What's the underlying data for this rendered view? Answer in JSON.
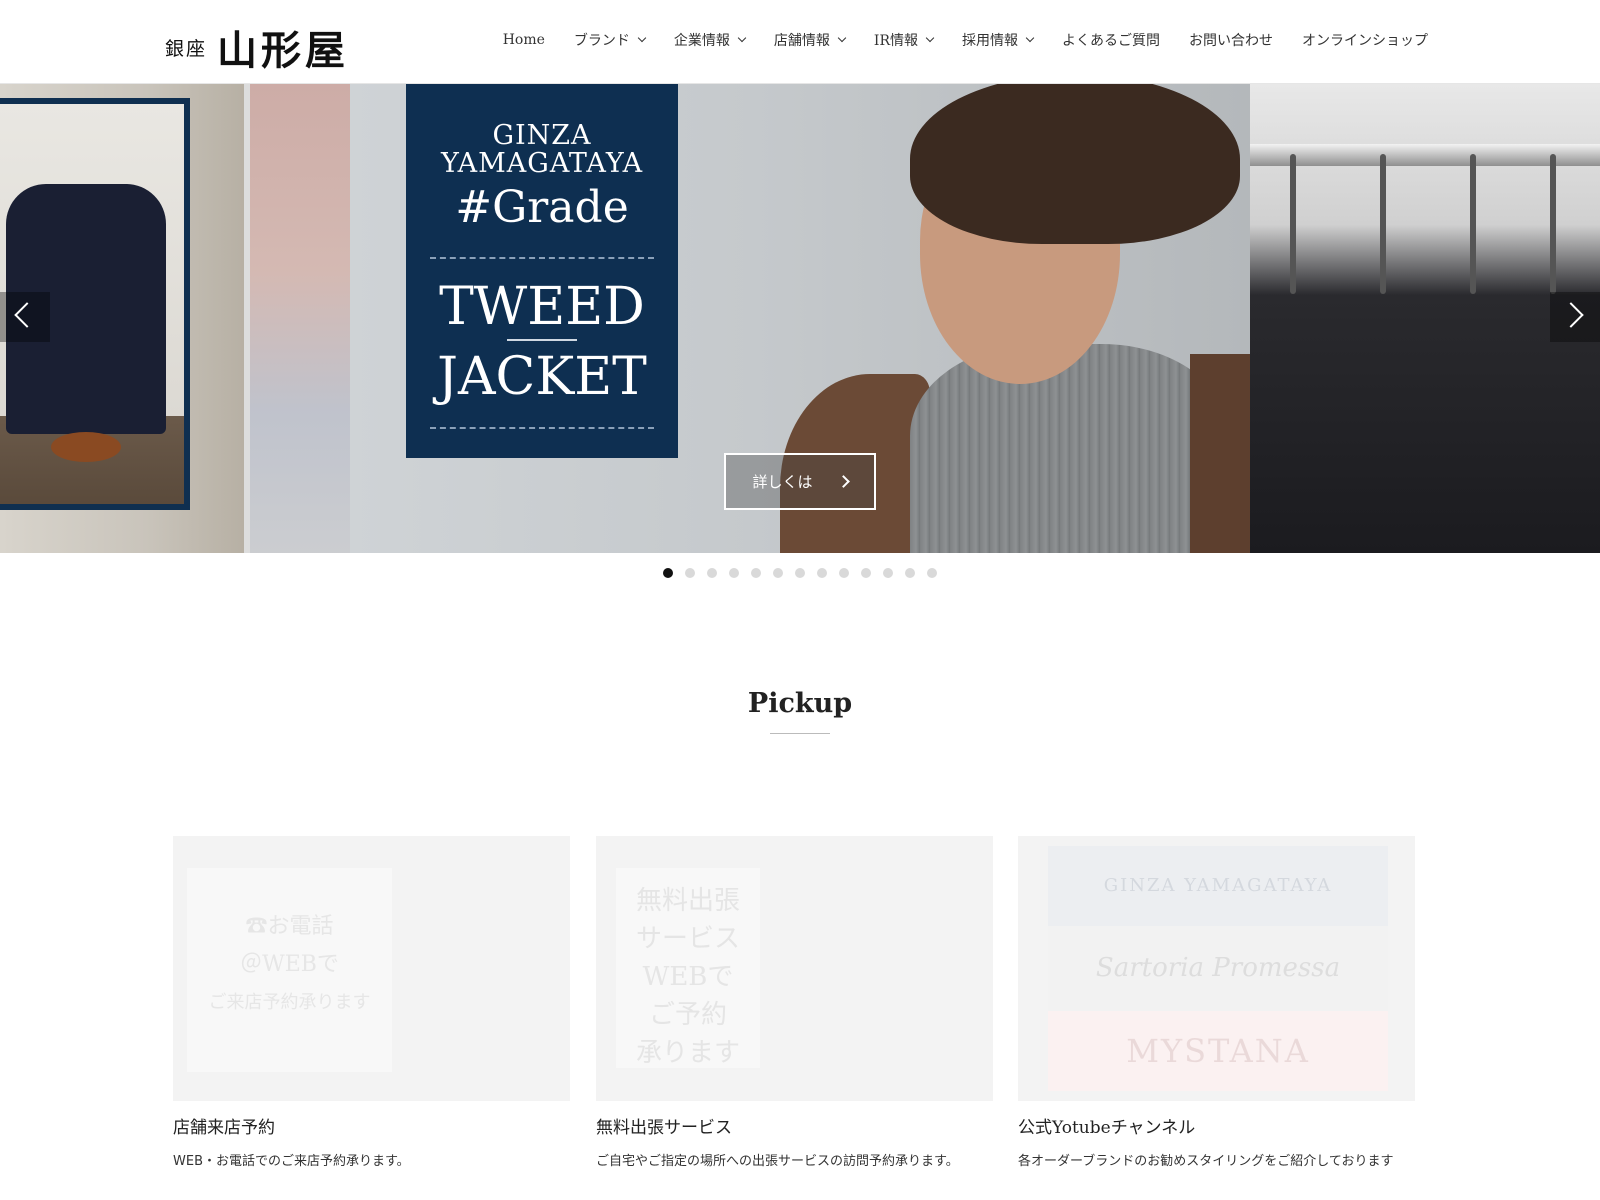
{
  "header": {
    "logo_small": "銀座",
    "logo_big": "山形屋",
    "nav": [
      {
        "label": "Home",
        "dropdown": false
      },
      {
        "label": "ブランド",
        "dropdown": true
      },
      {
        "label": "企業情報",
        "dropdown": true
      },
      {
        "label": "店舗情報",
        "dropdown": true
      },
      {
        "label": "IR情報",
        "dropdown": true
      },
      {
        "label": "採用情報",
        "dropdown": true
      },
      {
        "label": "よくあるご質問",
        "dropdown": false
      },
      {
        "label": "お問い合わせ",
        "dropdown": false
      },
      {
        "label": "オンラインショップ",
        "dropdown": false
      }
    ]
  },
  "hero": {
    "promo_brand_line1": "GINZA",
    "promo_brand_line2": "YAMAGATAYA",
    "promo_grade": "#Grade",
    "promo_title1": "TWEED",
    "promo_title2": "JACKET",
    "details_button": "詳しくは",
    "slide_count": 13,
    "active_slide": 1
  },
  "pickup": {
    "title": "Pickup",
    "cards": [
      {
        "title": "店舗来店予約",
        "desc": "WEB・お電話でのご来店予約承ります。",
        "img_text_1": "☎お電話",
        "img_text_2": "＠WEBで",
        "img_text_3": "ご来店予約承ります"
      },
      {
        "title": "無料出張サービス",
        "desc": "ご自宅やご指定の場所への出張サービスの訪問予約承ります。",
        "img_text_1": "無料出張",
        "img_text_2": "サービス",
        "img_text_3": "WEBで",
        "img_text_4": "ご予約",
        "img_text_5": "承ります"
      },
      {
        "title": "公式Yotubeチャンネル",
        "desc": "各オーダーブランドのお勧めスタイリングをご紹介しております",
        "img_text_1": "GINZA YAMAGATAYA",
        "img_text_2": "Sartoria Promessa",
        "img_text_3": "MYSTANA"
      }
    ]
  }
}
